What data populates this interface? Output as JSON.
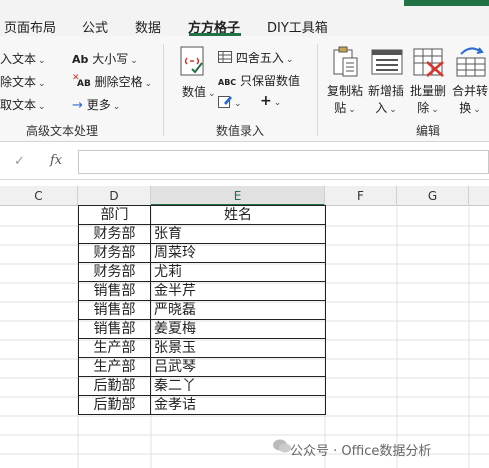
{
  "tabs": [
    "页面布局",
    "公式",
    "数据",
    "方方格子",
    "DIY工具箱"
  ],
  "active_tab": "方方格子",
  "ribbon": {
    "left_col": [
      "插入文本",
      "删除文本",
      "截取文本"
    ],
    "mid_col": [
      "大小写",
      "删除空格",
      "更多"
    ],
    "group1_label": "高级文本处理",
    "numeric_label": "数值",
    "round_label": "四舍五入",
    "keep_numeric_label": "只保留数值",
    "plus_label": "+",
    "group2_label": "数值录入",
    "copy_paste_label": [
      "复制粘",
      "贴"
    ],
    "insert_label": [
      "新增插",
      "入"
    ],
    "delete_label": [
      "批量删",
      "除"
    ],
    "merge_label": [
      "合并转",
      "换"
    ],
    "group3_label": "编辑",
    "ab_prefix": "Ab",
    "xab_prefix": "AB",
    "abc_prefix": "ABC"
  },
  "formula_bar": {
    "check": "✓",
    "fx": "fx",
    "value": ""
  },
  "columns": [
    "C",
    "D",
    "E",
    "F",
    "G"
  ],
  "selected_column": "E",
  "table": {
    "headers": [
      "部门",
      "姓名"
    ],
    "rows": [
      [
        "财务部",
        "张育"
      ],
      [
        "财务部",
        "周菜玲"
      ],
      [
        "财务部",
        "尤莉"
      ],
      [
        "销售部",
        "金半芹"
      ],
      [
        "销售部",
        "严晓磊"
      ],
      [
        "销售部",
        "姜夏梅"
      ],
      [
        "生产部",
        "张景玉"
      ],
      [
        "生产部",
        "吕武琴"
      ],
      [
        "后勤部",
        "秦二丫"
      ],
      [
        "后勤部",
        "金孝诘"
      ]
    ]
  },
  "watermark": "公众号 · Office数据分析",
  "colors": {
    "accent": "#217346",
    "ribbon_bg": "#f7f7f7",
    "tab_bg": "#f3f3f3",
    "red_x": "#d9342b",
    "blue_arrow": "#2b6cd1"
  }
}
